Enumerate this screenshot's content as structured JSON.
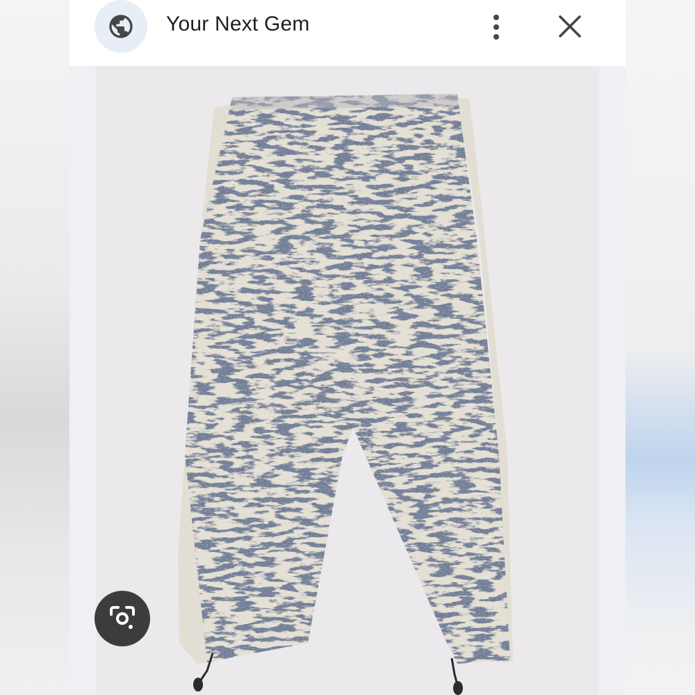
{
  "header": {
    "title": "Your Next Gem",
    "site_icon": "globe-icon",
    "more_icon": "more-vertical-icon",
    "close_icon": "close-icon"
  },
  "image": {
    "content": "product-photo-knit-pants"
  },
  "actions": {
    "lens_icon": "lens-search-icon"
  },
  "colors": {
    "icon_bg": "#e8eef5",
    "icon": "#444746",
    "title": "#1f1f1f",
    "pants_navy": "#2c3650",
    "pants_cream": "#e6e1d6",
    "side_stripe": "#e3ded3",
    "image_bg": "#ebe9ec"
  }
}
